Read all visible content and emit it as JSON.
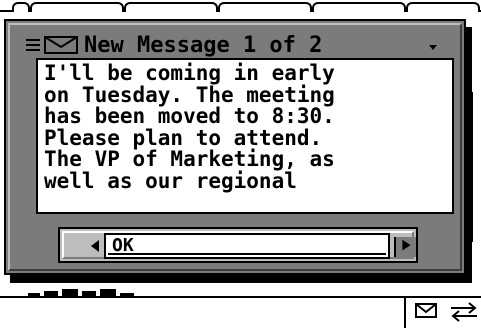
{
  "dialog": {
    "title": "New Message 1 of 2",
    "message_lines": [
      "I'll be coming in early",
      "on Tuesday. The meeting",
      "has been moved to 8:30.",
      "Please plan to attend.",
      "The VP of Marketing, as",
      "well as our regional"
    ],
    "buttons": {
      "ok_label": "OK"
    }
  },
  "icons": {
    "menu": "menu-lines-icon",
    "mail": "envelope-icon",
    "dropdown": "dropdown-arrow-icon",
    "scroll_left": "left-arrow-icon",
    "scroll_right": "right-arrow-icon",
    "status_mail": "envelope-icon",
    "status_swap": "swap-arrows-icon"
  },
  "colors": {
    "dialog_frame": "#7b7b7b",
    "button_bar": "#bdbdbd",
    "text": "#000000",
    "background": "#ffffff"
  }
}
